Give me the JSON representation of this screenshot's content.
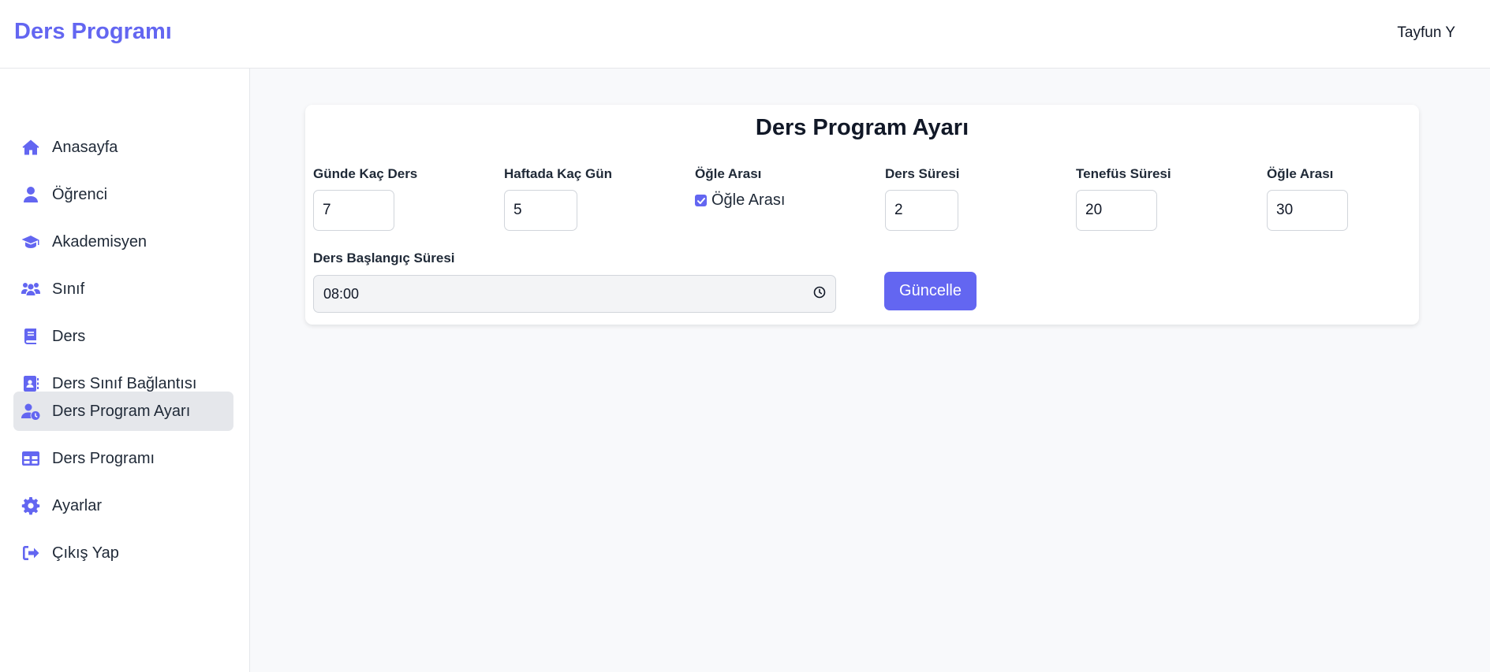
{
  "header": {
    "brand": "Ders Programı",
    "user_name": "Tayfun Y"
  },
  "sidebar": {
    "active_index": 6,
    "items": [
      {
        "label": "Anasayfa",
        "icon": "home-icon"
      },
      {
        "label": "Öğrenci",
        "icon": "user-icon"
      },
      {
        "label": "Akademisyen",
        "icon": "graduation-cap-icon"
      },
      {
        "label": "Sınıf",
        "icon": "users-icon"
      },
      {
        "label": "Ders",
        "icon": "book-icon"
      },
      {
        "label": "Ders Sınıf Bağlantısı",
        "icon": "address-book-icon"
      },
      {
        "label": "Ders Program Ayarı",
        "icon": "user-clock-icon"
      },
      {
        "label": "Ders Programı",
        "icon": "table-icon"
      },
      {
        "label": "Ayarlar",
        "icon": "gear-icon"
      },
      {
        "label": "Çıkış Yap",
        "icon": "sign-out-icon"
      }
    ]
  },
  "form": {
    "title": "Ders Program Ayarı",
    "daily_lessons": {
      "label": "Günde Kaç Ders",
      "value": "7"
    },
    "weekly_days": {
      "label": "Haftada Kaç Gün",
      "value": "5"
    },
    "lunch_toggle": {
      "label": "Öğle Arası",
      "checkbox_label": "Öğle Arası",
      "checked": true
    },
    "lesson_duration": {
      "label": "Ders Süresi",
      "value": "2"
    },
    "break_duration": {
      "label": "Tenefüs Süresi",
      "value": "20"
    },
    "lunch_duration": {
      "label": "Öğle Arası",
      "value": "30"
    },
    "start_time": {
      "label": "Ders Başlangıç Süresi",
      "value": "08:00"
    },
    "submit_label": "Güncelle"
  },
  "colors": {
    "accent": "#6366f1",
    "active_bg": "#e5e7eb",
    "page_bg": "#f8f9fb"
  }
}
